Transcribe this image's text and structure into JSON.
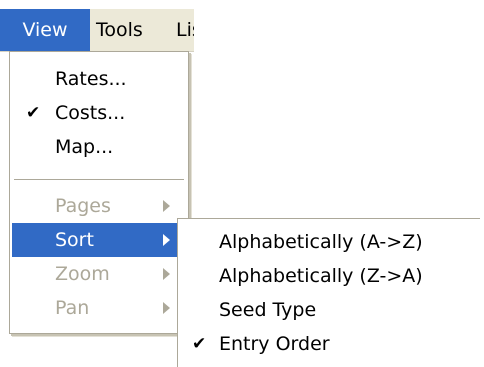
{
  "menubar": {
    "items": [
      {
        "label": "View",
        "active": true
      },
      {
        "label": "Tools",
        "active": false
      },
      {
        "label": "Lis",
        "active": false
      }
    ]
  },
  "view_menu": {
    "items": [
      {
        "label": "Rates...",
        "checked": false,
        "enabled": true
      },
      {
        "label": "Costs...",
        "checked": true,
        "enabled": true,
        "check_glyph": "✔"
      },
      {
        "label": "Map...",
        "checked": false,
        "enabled": true
      },
      {
        "label": "Pages",
        "enabled": false,
        "has_submenu": true
      },
      {
        "label": "Sort",
        "enabled": true,
        "has_submenu": true,
        "highlighted": true
      },
      {
        "label": "Zoom",
        "enabled": false,
        "has_submenu": true
      },
      {
        "label": "Pan",
        "enabled": false,
        "has_submenu": true
      }
    ]
  },
  "sort_submenu": {
    "items": [
      {
        "label": "Alphabetically (A->Z)",
        "checked": false
      },
      {
        "label": "Alphabetically (Z->A)",
        "checked": false
      },
      {
        "label": "Seed Type",
        "checked": false
      },
      {
        "label": "Entry Order",
        "checked": true,
        "check_glyph": "✔"
      }
    ]
  },
  "colors": {
    "menubar_bg": "#ece9d8",
    "highlight": "#316ac5",
    "disabled_text": "#aca899",
    "menu_bg": "#ffffff"
  },
  "icons": {
    "check": "check-icon",
    "submenu_arrow": "chevron-right-icon"
  }
}
